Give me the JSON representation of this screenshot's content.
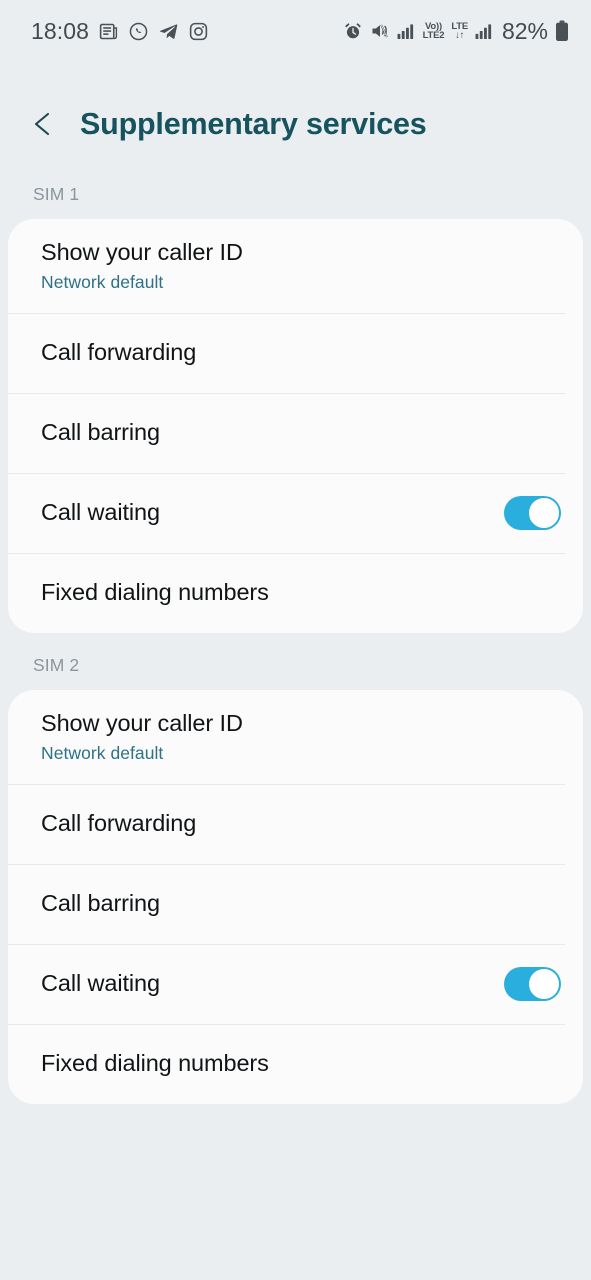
{
  "statusbar": {
    "time": "18:08",
    "left_icons": [
      {
        "name": "news-icon",
        "label": "news"
      },
      {
        "name": "whatsapp-icon",
        "label": "WhatsApp"
      },
      {
        "name": "telegram-icon",
        "label": "Telegram"
      },
      {
        "name": "instagram-icon",
        "label": "Instagram"
      }
    ],
    "right_icons": [
      {
        "name": "alarm-icon",
        "label": "alarm"
      },
      {
        "name": "mute-icon",
        "label": "sound off"
      }
    ],
    "sim1_network": {
      "volte": "Vo))",
      "label": "LTE2"
    },
    "sim2_network": {
      "tech": "LTE",
      "data_arrows": "↓↑"
    },
    "battery_percent": "82%"
  },
  "header": {
    "back_icon": "chevron-left-icon",
    "title": "Supplementary services",
    "title_color": "#16535e"
  },
  "colors": {
    "background": "#eaeef0",
    "card": "#fbfbfb",
    "accent_toggle": "#2aaede",
    "subtitle": "#2e7186",
    "section_label": "#8a969c"
  },
  "sections": [
    {
      "label": "SIM 1",
      "rows": [
        {
          "title": "Show your caller ID",
          "subtitle": "Network default",
          "control": "none"
        },
        {
          "title": "Call forwarding",
          "subtitle": null,
          "control": "none"
        },
        {
          "title": "Call barring",
          "subtitle": null,
          "control": "none"
        },
        {
          "title": "Call waiting",
          "subtitle": null,
          "control": "toggle",
          "toggle_on": true
        },
        {
          "title": "Fixed dialing numbers",
          "subtitle": null,
          "control": "none"
        }
      ]
    },
    {
      "label": "SIM 2",
      "rows": [
        {
          "title": "Show your caller ID",
          "subtitle": "Network default",
          "control": "none"
        },
        {
          "title": "Call forwarding",
          "subtitle": null,
          "control": "none"
        },
        {
          "title": "Call barring",
          "subtitle": null,
          "control": "none"
        },
        {
          "title": "Call waiting",
          "subtitle": null,
          "control": "toggle",
          "toggle_on": true
        },
        {
          "title": "Fixed dialing numbers",
          "subtitle": null,
          "control": "none"
        }
      ]
    }
  ]
}
